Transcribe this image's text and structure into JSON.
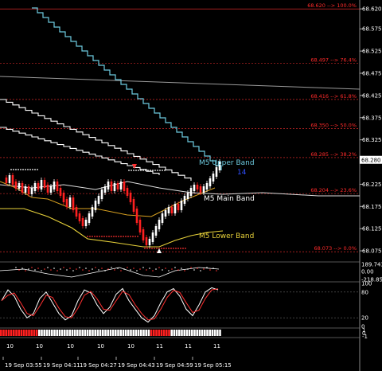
{
  "chart_data": {
    "type": "line",
    "title": "",
    "price_axis": [
      "68.620",
      "68.575",
      "68.525",
      "68.475",
      "68.425",
      "68.375",
      "68.325",
      "68.280",
      "68.225",
      "68.175",
      "68.125",
      "68.075"
    ],
    "current_price": "68.280",
    "fib_levels": [
      {
        "label": "68.620 --> 100.0%"
      },
      {
        "label": "68.497 --> 76.4%"
      },
      {
        "label": "68.416 --> 61.8%"
      },
      {
        "label": "68.350 --> 50.0%"
      },
      {
        "label": "68.285 --> 38.2%"
      },
      {
        "label": "68.204 --> 23.6%"
      },
      {
        "label": "68.073 --> 0.0%"
      }
    ],
    "bands": {
      "upper": {
        "label": "M5 Upper Band",
        "color": "#6ecbe0"
      },
      "main": {
        "label": "M5 Main Band",
        "color": "#ffffff"
      },
      "lower": {
        "label": "M5 Lower Band",
        "color": "#e8d23a"
      }
    },
    "counter": "14",
    "indicator1": {
      "axis": [
        "189.743",
        "0.00",
        "-218.852"
      ]
    },
    "indicator2": {
      "axis": [
        "100",
        "80",
        "20",
        "0"
      ]
    },
    "indicator3": {
      "axis": [
        "1",
        "0",
        "-1"
      ]
    },
    "time_labels": [
      "19 Sep 03:55",
      "19 Sep 04:11",
      "19 Sep 04:27",
      "19 Sep 04:43",
      "19 Sep 04:59",
      "19 Sep 05:15"
    ],
    "hour_labels": [
      "10",
      "10",
      "10",
      "10",
      "10",
      "11",
      "11",
      "11"
    ],
    "colors": {
      "bull": "#ffffff",
      "bear": "#ff2020",
      "grid": "#2a2a2a",
      "stoch_main": "#ffffff",
      "stoch_signal": "#ff3030"
    }
  }
}
